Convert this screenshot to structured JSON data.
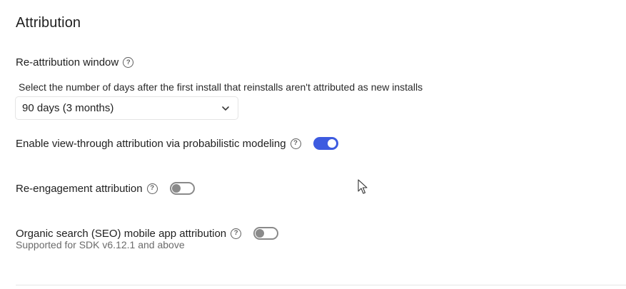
{
  "section": {
    "title": "Attribution"
  },
  "reattribution": {
    "label": "Re-attribution window",
    "description": "Select the number of days after the first install that reinstalls aren't attributed as new installs",
    "selected_value": "90 days (3 months)",
    "help_icon": "question-circle-icon",
    "chevron_icon": "chevron-down-icon"
  },
  "view_through": {
    "label": "Enable view-through attribution via probabilistic modeling",
    "enabled": true
  },
  "reengagement": {
    "label": "Re-engagement attribution",
    "enabled": false
  },
  "organic_search": {
    "label": "Organic search (SEO) mobile app attribution",
    "subtext": "Supported for SDK v6.12.1 and above",
    "enabled": false
  },
  "colors": {
    "accent": "#3d5be0",
    "toggle_off": "#8a8a8a",
    "text": "#1f1f1f",
    "muted_text": "#6b6b6b"
  }
}
